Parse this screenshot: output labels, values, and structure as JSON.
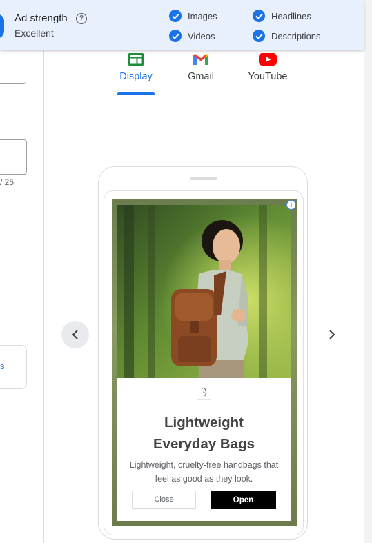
{
  "banner": {
    "title": "Ad strength",
    "value": "Excellent",
    "checks": [
      "Images",
      "Headlines",
      "Videos",
      "Descriptions"
    ]
  },
  "tabs": [
    {
      "label": "Display",
      "active": true
    },
    {
      "label": "Gmail",
      "active": false
    },
    {
      "label": "YouTube",
      "active": false
    }
  ],
  "left_panel": {
    "counter": "/ 25",
    "link_fragment": "s"
  },
  "ad": {
    "headline_line1": "Lightweight",
    "headline_line2": "Everyday Bags",
    "description": "Lightweight, cruelty-free handbags that feel as good as they look.",
    "close_label": "Close",
    "open_label": "Open"
  },
  "colors": {
    "accent": "#1a73e8",
    "banner_bg": "#e8f0fe",
    "open_button": "#000000"
  }
}
